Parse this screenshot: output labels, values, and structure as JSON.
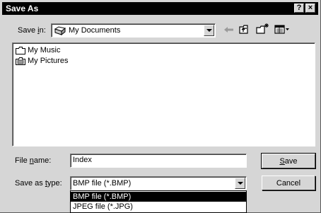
{
  "window": {
    "title": "Save As",
    "help_button": "?",
    "close_button": "×"
  },
  "toolbar": {
    "save_in_prefix": "Save ",
    "save_in_u": "i",
    "save_in_suffix": "n:",
    "location": "My Documents",
    "location_icon": "my-documents-icon",
    "back_icon": "back-arrow-icon",
    "up_icon": "up-one-level-icon",
    "new_folder_icon": "new-folder-icon",
    "views_icon": "views-menu-icon"
  },
  "files": [
    {
      "name": "My Music",
      "icon": "folder-icon"
    },
    {
      "name": "My Pictures",
      "icon": "pictures-folder-icon"
    }
  ],
  "filename": {
    "label_prefix": "File ",
    "label_u": "n",
    "label_suffix": "ame:",
    "value": "Index"
  },
  "filetype": {
    "label_prefix": "Save as ",
    "label_u": "t",
    "label_suffix": "ype:",
    "value": "BMP file (*.BMP)",
    "options": [
      "BMP file (*.BMP)",
      "JPEG file (*.JPG)"
    ],
    "selected_index": 0
  },
  "buttons": {
    "save_u": "S",
    "save_rest": "ave",
    "cancel": "Cancel"
  },
  "colors": {
    "face": "#d6d6d6",
    "titlebar": "#000000",
    "selection": "#000000"
  }
}
